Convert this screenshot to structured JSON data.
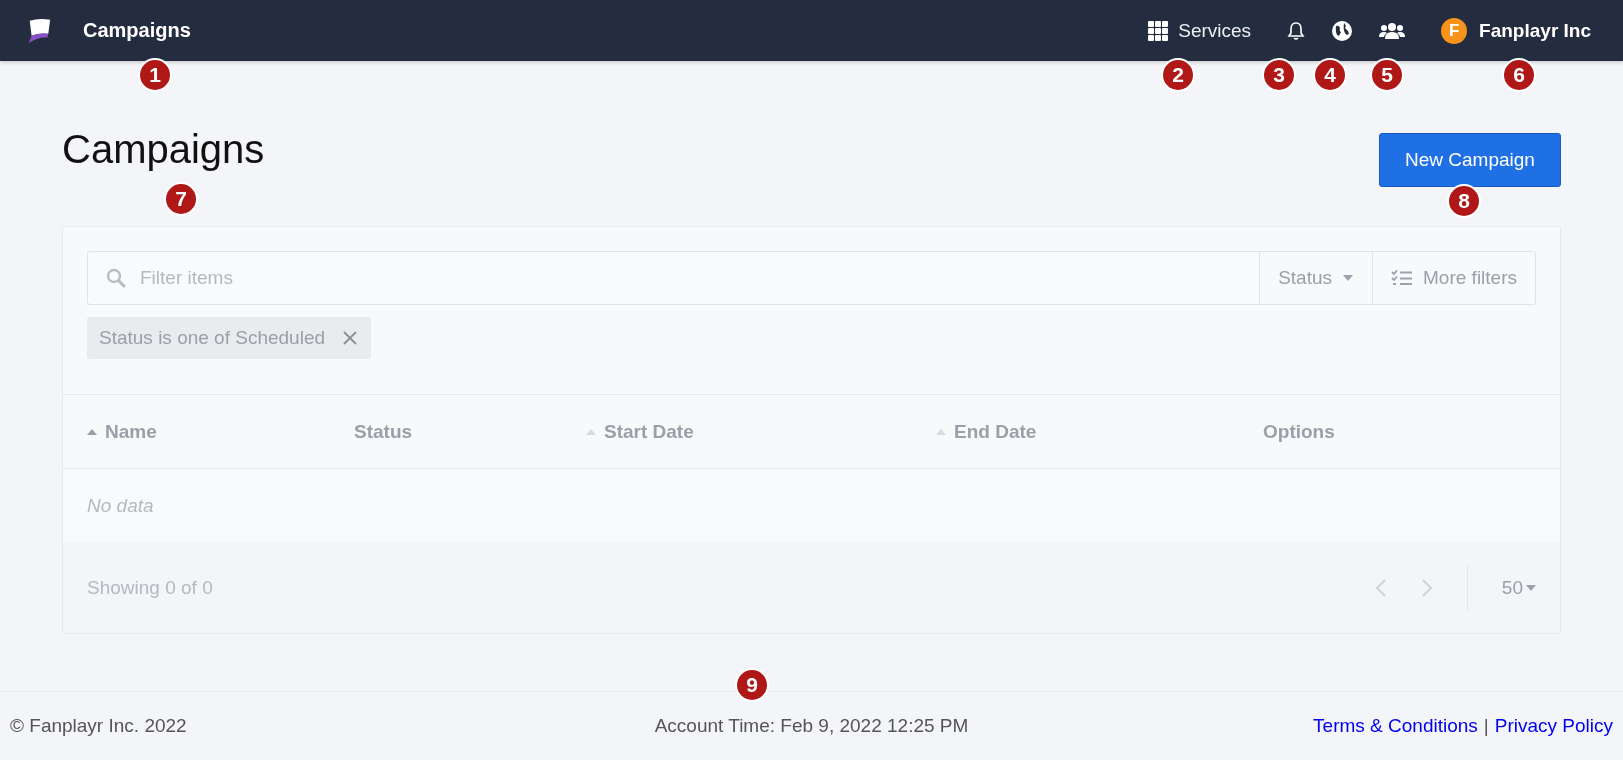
{
  "header": {
    "title": "Campaigns",
    "nav": [
      {
        "kind": "services",
        "label": "Services"
      },
      {
        "kind": "bell"
      },
      {
        "kind": "globe"
      },
      {
        "kind": "users"
      }
    ],
    "account": {
      "initial": "F",
      "name": "Fanplayr Inc"
    }
  },
  "page": {
    "title": "Campaigns",
    "new_button": "New Campaign"
  },
  "filters": {
    "search_placeholder": "Filter items",
    "status_button": "Status",
    "more_button": "More filters",
    "chips": [
      {
        "label": "Status is one of Scheduled"
      }
    ]
  },
  "table": {
    "columns": [
      {
        "label": "Name",
        "sortable": true,
        "selected": true
      },
      {
        "label": "Status",
        "sortable": false
      },
      {
        "label": "Start Date",
        "sortable": true,
        "selected": false
      },
      {
        "label": "End Date",
        "sortable": true,
        "selected": false
      },
      {
        "label": "Options",
        "sortable": false
      }
    ],
    "empty_text": "No data",
    "showing": "Showing 0 of 0",
    "page_size": "50"
  },
  "footer": {
    "copyright": "© Fanplayr Inc. 2022",
    "account_time": "Account Time: Feb 9, 2022 12:25 PM",
    "links": [
      "Terms & Conditions",
      "Privacy Policy"
    ],
    "separator": "|"
  },
  "callouts": [
    "1",
    "2",
    "3",
    "4",
    "5",
    "6",
    "7",
    "8",
    "9"
  ]
}
